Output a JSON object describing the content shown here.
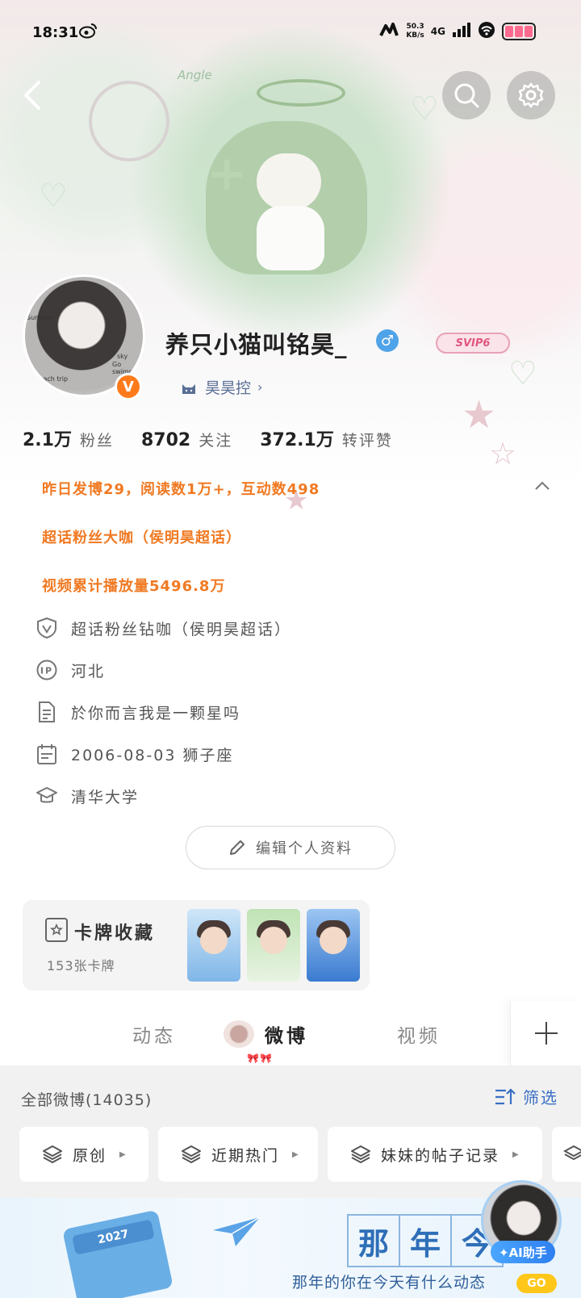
{
  "status_bar": {
    "time": "18:31",
    "speed_value": "50.3",
    "speed_unit": "KB/s",
    "network": "4G"
  },
  "header": {
    "banner_text": "Angle"
  },
  "profile": {
    "username": "养只小猫叫铭昊_",
    "gender": "♂",
    "vip_badge": "SVIP6",
    "fan_club": "昊昊控",
    "avatar_texts": [
      "Summer",
      "sky",
      "Go swimming",
      "Beach trip"
    ],
    "verified": "V"
  },
  "stats": [
    {
      "num": "2.1万",
      "label": "粉丝"
    },
    {
      "num": "8702",
      "label": "关注"
    },
    {
      "num": "372.1万",
      "label": "转评赞"
    }
  ],
  "highlights": [
    "昨日发博29，阅读数1万+，互动数498",
    "超话粉丝大咖（侯明昊超话）",
    "视频累计播放量5496.8万"
  ],
  "info": [
    {
      "icon": "shield-v-icon",
      "text": "超话粉丝钻咖（侯明昊超话）"
    },
    {
      "icon": "ip-icon",
      "text": "河北"
    },
    {
      "icon": "document-icon",
      "text": "於你而言我是一颗星吗"
    },
    {
      "icon": "calendar-icon",
      "text": "2006-08-03 狮子座"
    },
    {
      "icon": "graduation-cap-icon",
      "text": "清华大学"
    }
  ],
  "edit_button": "编辑个人资料",
  "cards": {
    "title": "卡牌收藏",
    "count": "153张卡牌"
  },
  "tabs": [
    {
      "label": "动态",
      "active": false
    },
    {
      "label": "微博",
      "active": true
    },
    {
      "label": "视频",
      "active": false
    }
  ],
  "feed": {
    "header": "全部微博(14035)",
    "filter": "筛选",
    "chips": [
      "原创",
      "近期热门",
      "妹妹的帖子记录"
    ]
  },
  "promo": {
    "calendar_year": "2027",
    "grid_chars": [
      "那",
      "年",
      "今"
    ],
    "caption": "那年的你在今天有什么动态",
    "go": "GO",
    "ai_label": "✦AI助手"
  },
  "colors": {
    "accent_orange": "#f07a23",
    "link_blue": "#3a6fc4",
    "fanclub": "#5a6f95"
  }
}
